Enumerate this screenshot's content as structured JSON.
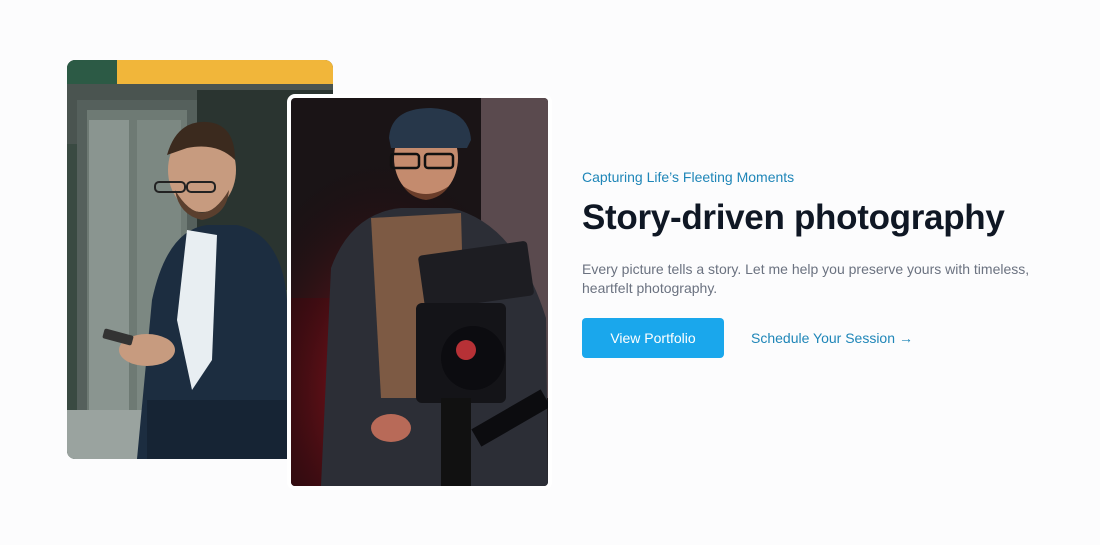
{
  "hero": {
    "eyebrow": "Capturing Life’s Fleeting Moments",
    "headline": "Story-driven photography",
    "lead": "Every picture tells a story. Let me help you preserve yours with timeless, heartfelt photography.",
    "primary_button": "View Portfolio",
    "secondary_link": "Schedule Your Session",
    "secondary_link_icon": "arrow-right-icon"
  },
  "colors": {
    "accent": "#1aa7ec",
    "link": "#1f86b8",
    "heading": "#0f1724",
    "body_text": "#6b7280"
  },
  "images": [
    {
      "subject": "man-in-suit-using-phone"
    },
    {
      "subject": "photographer-with-camera-red-light"
    }
  ]
}
